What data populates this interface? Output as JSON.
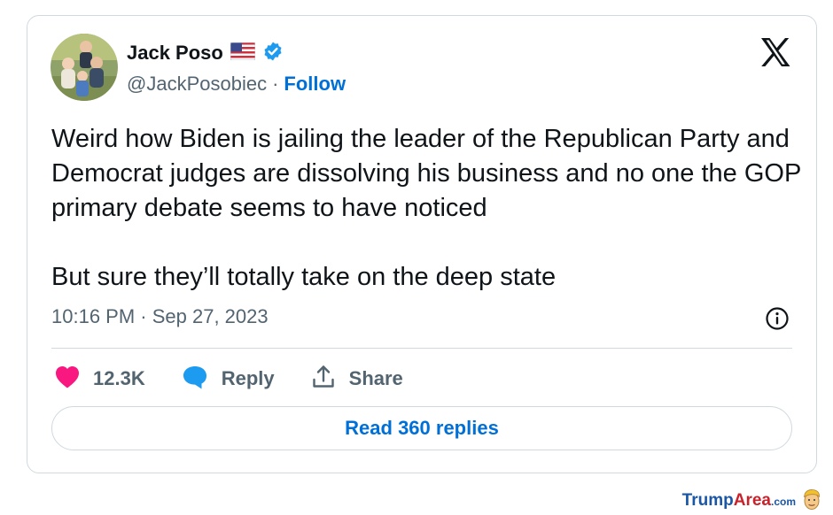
{
  "tweet": {
    "author": {
      "display_name": "Jack Poso",
      "handle": "@JackPosobiec",
      "separator": "·",
      "follow_label": "Follow",
      "flag_icon": "us-flag-icon",
      "verified_icon": "verified-badge-icon"
    },
    "platform_icon": "x-logo-icon",
    "text": {
      "paragraph_1": "Weird how Biden is jailing the leader of the Republican Party and Democrat judges are dissolving his business and no one the GOP primary debate seems to have noticed",
      "paragraph_2": "But sure they’ll totally take on the deep state"
    },
    "timestamp": "10:16 PM · Sep 27, 2023",
    "info_icon": "info-icon",
    "actions": {
      "like_count": "12.3K",
      "reply_label": "Reply",
      "share_label": "Share"
    },
    "read_replies_label": "Read 360 replies"
  },
  "watermark": {
    "brand_part_1": "Trump",
    "brand_part_2": "Area",
    "brand_suffix": ".com"
  },
  "colors": {
    "link_blue": "#006fd6",
    "verified_blue": "#1d9bf0",
    "like_pink": "#f91880",
    "reply_blue": "#1d9bf0",
    "muted_text": "#536471",
    "border": "#cfd9de"
  }
}
